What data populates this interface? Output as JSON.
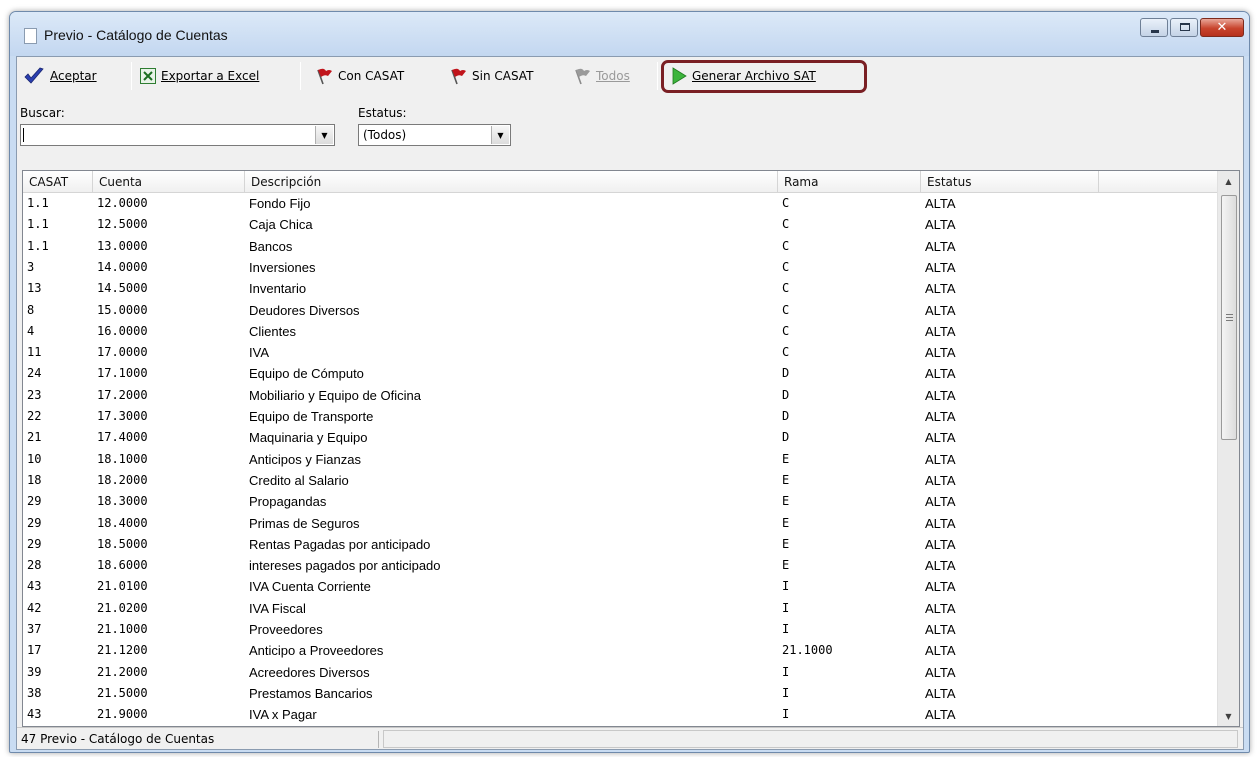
{
  "window": {
    "title": "Previo - Catálogo de Cuentas"
  },
  "toolbar": {
    "aceptar_label": "Aceptar",
    "exportar_label": "Exportar a Excel",
    "con_casat_label": "Con CASAT",
    "sin_casat_label": "Sin CASAT",
    "todos_label": "Todos",
    "generar_label": "Generar Archivo SAT"
  },
  "filters": {
    "buscar_label": "Buscar:",
    "buscar_value": "",
    "estatus_label": "Estatus:",
    "estatus_value": "(Todos)"
  },
  "grid": {
    "columns": [
      "CASAT",
      "Cuenta",
      "Descripción",
      "Rama",
      "Estatus"
    ],
    "rows": [
      [
        "1.1",
        "12.0000",
        "Fondo Fijo",
        "C",
        "ALTA"
      ],
      [
        "1.1",
        "12.5000",
        "Caja Chica",
        "C",
        "ALTA"
      ],
      [
        "1.1",
        "13.0000",
        "Bancos",
        "C",
        "ALTA"
      ],
      [
        "3",
        "14.0000",
        "Inversiones",
        "C",
        "ALTA"
      ],
      [
        "13",
        "14.5000",
        "Inventario",
        "C",
        "ALTA"
      ],
      [
        "8",
        "15.0000",
        "Deudores Diversos",
        "C",
        "ALTA"
      ],
      [
        "4",
        "16.0000",
        "Clientes",
        "C",
        "ALTA"
      ],
      [
        "11",
        "17.0000",
        "IVA",
        "C",
        "ALTA"
      ],
      [
        "24",
        "17.1000",
        "Equipo de Cómputo",
        "D",
        "ALTA"
      ],
      [
        "23",
        "17.2000",
        "Mobiliario y Equipo de Oficina",
        "D",
        "ALTA"
      ],
      [
        "22",
        "17.3000",
        "Equipo de Transporte",
        "D",
        "ALTA"
      ],
      [
        "21",
        "17.4000",
        "Maquinaria y Equipo",
        "D",
        "ALTA"
      ],
      [
        "10",
        "18.1000",
        "Anticipos y Fianzas",
        "E",
        "ALTA"
      ],
      [
        "18",
        "18.2000",
        "Credito al Salario",
        "E",
        "ALTA"
      ],
      [
        "29",
        "18.3000",
        "Propagandas",
        "E",
        "ALTA"
      ],
      [
        "29",
        "18.4000",
        "Primas de Seguros",
        "E",
        "ALTA"
      ],
      [
        "29",
        "18.5000",
        "Rentas Pagadas por anticipado",
        "E",
        "ALTA"
      ],
      [
        "28",
        "18.6000",
        "intereses pagados por anticipado",
        "E",
        "ALTA"
      ],
      [
        "43",
        "21.0100",
        "IVA Cuenta Corriente",
        "I",
        "ALTA"
      ],
      [
        "42",
        "21.0200",
        "IVA Fiscal",
        "I",
        "ALTA"
      ],
      [
        "37",
        "21.1000",
        "Proveedores",
        "I",
        "ALTA"
      ],
      [
        "17",
        "21.1200",
        "Anticipo a Proveedores",
        "21.1000",
        "ALTA"
      ],
      [
        "39",
        "21.2000",
        "Acreedores Diversos",
        "I",
        "ALTA"
      ],
      [
        "38",
        "21.5000",
        "Prestamos Bancarios",
        "I",
        "ALTA"
      ],
      [
        "43",
        "21.9000",
        "IVA x Pagar",
        "I",
        "ALTA"
      ]
    ]
  },
  "statusbar": {
    "text": "47 Previo - Catálogo de Cuentas"
  },
  "colors": {
    "highlight_box": "#7a1f24",
    "close_button": "#c8442d",
    "flag_red": "#c0141b"
  },
  "icons": [
    "document-icon",
    "checkmark-icon",
    "excel-icon",
    "red-flag-icon",
    "gray-flag-icon",
    "green-play-icon"
  ]
}
